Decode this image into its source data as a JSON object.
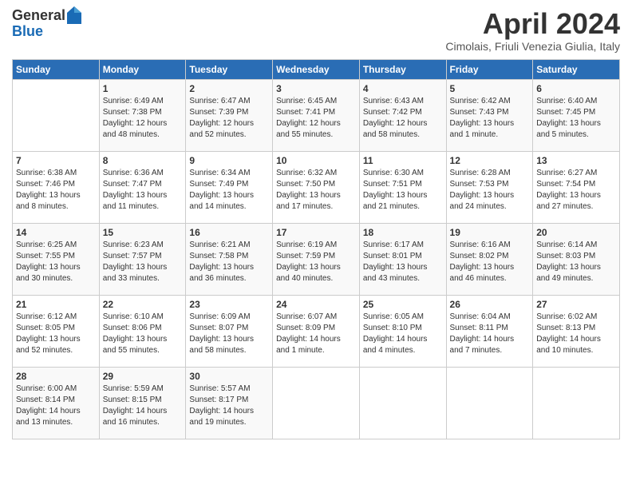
{
  "header": {
    "logo_general": "General",
    "logo_blue": "Blue",
    "title": "April 2024",
    "location": "Cimolais, Friuli Venezia Giulia, Italy"
  },
  "days_of_week": [
    "Sunday",
    "Monday",
    "Tuesday",
    "Wednesday",
    "Thursday",
    "Friday",
    "Saturday"
  ],
  "weeks": [
    [
      {
        "day": "",
        "sunrise": "",
        "sunset": "",
        "daylight": ""
      },
      {
        "day": "1",
        "sunrise": "Sunrise: 6:49 AM",
        "sunset": "Sunset: 7:38 PM",
        "daylight": "Daylight: 12 hours and 48 minutes."
      },
      {
        "day": "2",
        "sunrise": "Sunrise: 6:47 AM",
        "sunset": "Sunset: 7:39 PM",
        "daylight": "Daylight: 12 hours and 52 minutes."
      },
      {
        "day": "3",
        "sunrise": "Sunrise: 6:45 AM",
        "sunset": "Sunset: 7:41 PM",
        "daylight": "Daylight: 12 hours and 55 minutes."
      },
      {
        "day": "4",
        "sunrise": "Sunrise: 6:43 AM",
        "sunset": "Sunset: 7:42 PM",
        "daylight": "Daylight: 12 hours and 58 minutes."
      },
      {
        "day": "5",
        "sunrise": "Sunrise: 6:42 AM",
        "sunset": "Sunset: 7:43 PM",
        "daylight": "Daylight: 13 hours and 1 minute."
      },
      {
        "day": "6",
        "sunrise": "Sunrise: 6:40 AM",
        "sunset": "Sunset: 7:45 PM",
        "daylight": "Daylight: 13 hours and 5 minutes."
      }
    ],
    [
      {
        "day": "7",
        "sunrise": "Sunrise: 6:38 AM",
        "sunset": "Sunset: 7:46 PM",
        "daylight": "Daylight: 13 hours and 8 minutes."
      },
      {
        "day": "8",
        "sunrise": "Sunrise: 6:36 AM",
        "sunset": "Sunset: 7:47 PM",
        "daylight": "Daylight: 13 hours and 11 minutes."
      },
      {
        "day": "9",
        "sunrise": "Sunrise: 6:34 AM",
        "sunset": "Sunset: 7:49 PM",
        "daylight": "Daylight: 13 hours and 14 minutes."
      },
      {
        "day": "10",
        "sunrise": "Sunrise: 6:32 AM",
        "sunset": "Sunset: 7:50 PM",
        "daylight": "Daylight: 13 hours and 17 minutes."
      },
      {
        "day": "11",
        "sunrise": "Sunrise: 6:30 AM",
        "sunset": "Sunset: 7:51 PM",
        "daylight": "Daylight: 13 hours and 21 minutes."
      },
      {
        "day": "12",
        "sunrise": "Sunrise: 6:28 AM",
        "sunset": "Sunset: 7:53 PM",
        "daylight": "Daylight: 13 hours and 24 minutes."
      },
      {
        "day": "13",
        "sunrise": "Sunrise: 6:27 AM",
        "sunset": "Sunset: 7:54 PM",
        "daylight": "Daylight: 13 hours and 27 minutes."
      }
    ],
    [
      {
        "day": "14",
        "sunrise": "Sunrise: 6:25 AM",
        "sunset": "Sunset: 7:55 PM",
        "daylight": "Daylight: 13 hours and 30 minutes."
      },
      {
        "day": "15",
        "sunrise": "Sunrise: 6:23 AM",
        "sunset": "Sunset: 7:57 PM",
        "daylight": "Daylight: 13 hours and 33 minutes."
      },
      {
        "day": "16",
        "sunrise": "Sunrise: 6:21 AM",
        "sunset": "Sunset: 7:58 PM",
        "daylight": "Daylight: 13 hours and 36 minutes."
      },
      {
        "day": "17",
        "sunrise": "Sunrise: 6:19 AM",
        "sunset": "Sunset: 7:59 PM",
        "daylight": "Daylight: 13 hours and 40 minutes."
      },
      {
        "day": "18",
        "sunrise": "Sunrise: 6:17 AM",
        "sunset": "Sunset: 8:01 PM",
        "daylight": "Daylight: 13 hours and 43 minutes."
      },
      {
        "day": "19",
        "sunrise": "Sunrise: 6:16 AM",
        "sunset": "Sunset: 8:02 PM",
        "daylight": "Daylight: 13 hours and 46 minutes."
      },
      {
        "day": "20",
        "sunrise": "Sunrise: 6:14 AM",
        "sunset": "Sunset: 8:03 PM",
        "daylight": "Daylight: 13 hours and 49 minutes."
      }
    ],
    [
      {
        "day": "21",
        "sunrise": "Sunrise: 6:12 AM",
        "sunset": "Sunset: 8:05 PM",
        "daylight": "Daylight: 13 hours and 52 minutes."
      },
      {
        "day": "22",
        "sunrise": "Sunrise: 6:10 AM",
        "sunset": "Sunset: 8:06 PM",
        "daylight": "Daylight: 13 hours and 55 minutes."
      },
      {
        "day": "23",
        "sunrise": "Sunrise: 6:09 AM",
        "sunset": "Sunset: 8:07 PM",
        "daylight": "Daylight: 13 hours and 58 minutes."
      },
      {
        "day": "24",
        "sunrise": "Sunrise: 6:07 AM",
        "sunset": "Sunset: 8:09 PM",
        "daylight": "Daylight: 14 hours and 1 minute."
      },
      {
        "day": "25",
        "sunrise": "Sunrise: 6:05 AM",
        "sunset": "Sunset: 8:10 PM",
        "daylight": "Daylight: 14 hours and 4 minutes."
      },
      {
        "day": "26",
        "sunrise": "Sunrise: 6:04 AM",
        "sunset": "Sunset: 8:11 PM",
        "daylight": "Daylight: 14 hours and 7 minutes."
      },
      {
        "day": "27",
        "sunrise": "Sunrise: 6:02 AM",
        "sunset": "Sunset: 8:13 PM",
        "daylight": "Daylight: 14 hours and 10 minutes."
      }
    ],
    [
      {
        "day": "28",
        "sunrise": "Sunrise: 6:00 AM",
        "sunset": "Sunset: 8:14 PM",
        "daylight": "Daylight: 14 hours and 13 minutes."
      },
      {
        "day": "29",
        "sunrise": "Sunrise: 5:59 AM",
        "sunset": "Sunset: 8:15 PM",
        "daylight": "Daylight: 14 hours and 16 minutes."
      },
      {
        "day": "30",
        "sunrise": "Sunrise: 5:57 AM",
        "sunset": "Sunset: 8:17 PM",
        "daylight": "Daylight: 14 hours and 19 minutes."
      },
      {
        "day": "",
        "sunrise": "",
        "sunset": "",
        "daylight": ""
      },
      {
        "day": "",
        "sunrise": "",
        "sunset": "",
        "daylight": ""
      },
      {
        "day": "",
        "sunrise": "",
        "sunset": "",
        "daylight": ""
      },
      {
        "day": "",
        "sunrise": "",
        "sunset": "",
        "daylight": ""
      }
    ]
  ]
}
